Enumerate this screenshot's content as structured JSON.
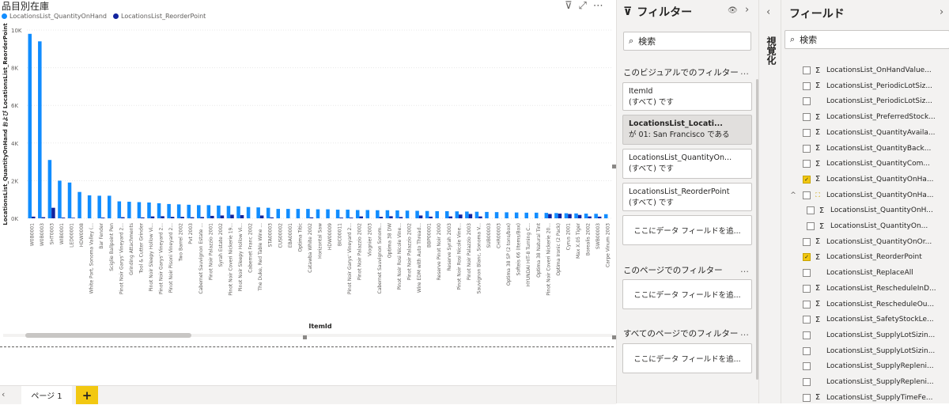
{
  "visual": {
    "title": "品目別在庫",
    "legend": [
      {
        "label": "LocationsList_QuantityOnHand",
        "color": "#118dff"
      },
      {
        "label": "LocationsList_ReorderPoint",
        "color": "#12239e"
      }
    ],
    "icons": [
      "filter-icon",
      "focus-mode-icon",
      "more-options-icon"
    ],
    "header_glyphs": {
      "filter": "⊽",
      "focus": "⤢",
      "more": "⋯"
    }
  },
  "chart_data": {
    "type": "bar",
    "title": "品目別在庫",
    "xlabel": "ItemId",
    "ylabel": "LocationsList_QuantityOnHand および LocationsList_ReorderPoint",
    "ylim": [
      0,
      10000
    ],
    "yticks": [
      "0K",
      "2K",
      "4K",
      "6K",
      "8K",
      "10K"
    ],
    "ytick_values": [
      0,
      2000,
      4000,
      6000,
      8000,
      10000
    ],
    "categories": [
      "W0B0001",
      "W0B0003",
      "SHT0003",
      "WIB0001",
      "LED00001",
      "HDW0008",
      "White Port, Sonoma Valley (...",
      "Bar Fender",
      "Sciglie Ballpoint Pen",
      "Pinot Noir Garys' Vineyard 2...",
      "Grinding Attachments",
      "Tool & Cutter Grinder",
      "Pinot Noir Sleepy Hollow Vi...",
      "Pinot Noir Garys' Vineyard 2...",
      "Pinot Noir Pisoni Vineyard 2...",
      "Two Barrel 2002",
      "Pvt 2003",
      "Cabernet Sauvignon Estate ...",
      "Pinot Noir Palazzio 2001",
      "Syrah Estate 2002",
      "Pinot Noir Coveri Nickerie 19...",
      "Pinot Noir Sleepy Hollow Vi...",
      "Cabernet Franc 2002",
      "The Duke, Red Table Wine ...",
      "STA00003",
      "CUS00002",
      "EBA00001",
      "Optima Titic",
      "Catawba White 2002",
      "Horizontal Saw",
      "HDW00009",
      "BIC00011",
      "Pinot Noir Garys' Vineyard 2...",
      "Pinot Noir Palazzio 2002",
      "Viognier 2003",
      "Cabernet Sauvignon Sonom...",
      "Optima 38 DW",
      "Pinot Noir Rosi Nicole Vine...",
      "Pinot Noir Palazzio 2002",
      "Wire EDM with Auto Thread...",
      "BBP00001",
      "Reserve Pinot Noir 2000",
      "Reserve Syrah 2003",
      "Pinot Noir Rosi Nicole Vine...",
      "Pinot Noir Palazzio 2003",
      "Sauvignon Blanc, Sonoma V...",
      "SUB00003",
      "CHR00003",
      "Optima 38 SP (2 tons/box)",
      "Softeis 66 (Items/Box)",
      "HYUNDAI HIT-8 Turning C...",
      "Optima 38 Natural Tint",
      "Pinot Noir Coveri Nickerie 20...",
      "Optima Ironic (2 Pack)",
      "Cyrus 2001",
      "Max X.05 Tiger",
      "Borealis 2002",
      "SWB00003",
      "Carpe Vinum 2003"
    ],
    "series": [
      {
        "name": "LocationsList_QuantityOnHand",
        "color": "#118dff",
        "values": [
          9800,
          9400,
          3100,
          2000,
          1900,
          1400,
          1220,
          1200,
          1200,
          900,
          880,
          860,
          840,
          800,
          760,
          740,
          720,
          700,
          700,
          680,
          660,
          640,
          600,
          580,
          560,
          500,
          500,
          500,
          500,
          480,
          480,
          460,
          460,
          440,
          440,
          430,
          430,
          420,
          410,
          400,
          390,
          380,
          380,
          370,
          360,
          350,
          340,
          330,
          320,
          310,
          300,
          300,
          290,
          280,
          270,
          260,
          250,
          240,
          220
        ]
      },
      {
        "name": "LocationsList_ReorderPoint",
        "color": "#12239e",
        "values": [
          90,
          60,
          560,
          40,
          30,
          0,
          0,
          40,
          0,
          60,
          0,
          50,
          100,
          110,
          80,
          80,
          60,
          70,
          130,
          150,
          190,
          170,
          0,
          150,
          50,
          0,
          0,
          0,
          50,
          0,
          0,
          40,
          40,
          100,
          0,
          80,
          110,
          70,
          0,
          150,
          90,
          0,
          100,
          200,
          230,
          100,
          0,
          0,
          0,
          0,
          0,
          0,
          230,
          250,
          230,
          180,
          100,
          90,
          0
        ]
      }
    ]
  },
  "pages": {
    "tab_label": "ページ 1",
    "add_label": "+",
    "nav_prev": "‹"
  },
  "filters": {
    "title": "フィルター",
    "search_placeholder": "検索",
    "glyphs": {
      "funnel": "⊽",
      "eye": "👁",
      "collapse": "›",
      "search": "⌕"
    },
    "visual_section": "このビジュアルでのフィルター",
    "page_section": "このページでのフィルター",
    "all_pages_section": "すべてのページでのフィルター",
    "more": "…",
    "cards": [
      {
        "name": "ItemId",
        "value": "(すべて) です"
      },
      {
        "name": "LocationsList_Locati...",
        "value": "が 01: San Francisco である"
      },
      {
        "name": "LocationsList_QuantityOn...",
        "value": "(すべて) です"
      },
      {
        "name": "LocationsList_ReorderPoint",
        "value": "(すべて) です"
      }
    ],
    "drop_label": "ここにデータ フィールドを追..."
  },
  "visualizations": {
    "label": "視覚化",
    "chevron": "‹"
  },
  "fields": {
    "title": "フィールド",
    "collapse": "›",
    "search_placeholder": "検索",
    "search_glyph": "⌕",
    "items": [
      {
        "label": "LocationsList_OnHandValue...",
        "icon": "Σ",
        "checked": false,
        "indent": 0
      },
      {
        "label": "LocationsList_PeriodicLotSiz...",
        "icon": "Σ",
        "checked": false,
        "indent": 0
      },
      {
        "label": "LocationsList_PeriodicLotSiz...",
        "icon": "",
        "checked": false,
        "indent": 0
      },
      {
        "label": "LocationsList_PreferredStock...",
        "icon": "Σ",
        "checked": false,
        "indent": 0
      },
      {
        "label": "LocationsList_QuantityAvaila...",
        "icon": "Σ",
        "checked": false,
        "indent": 0
      },
      {
        "label": "LocationsList_QuantityBack...",
        "icon": "Σ",
        "checked": false,
        "indent": 0
      },
      {
        "label": "LocationsList_QuantityCom...",
        "icon": "Σ",
        "checked": false,
        "indent": 0
      },
      {
        "label": "LocationsList_QuantityOnHa...",
        "icon": "Σ",
        "checked": true,
        "indent": 0
      },
      {
        "label": "LocationsList_QuantityOnHa...",
        "icon": "⛶",
        "checked": false,
        "indent": 0,
        "expander": "^",
        "hier": true
      },
      {
        "label": "LocationsList_QuantityOnH...",
        "icon": "Σ",
        "checked": false,
        "indent": 1
      },
      {
        "label": "LocationsList_QuantityOn...",
        "icon": "Σ",
        "checked": false,
        "indent": 1
      },
      {
        "label": "LocationsList_QuantityOnOr...",
        "icon": "Σ",
        "checked": false,
        "indent": 0
      },
      {
        "label": "LocationsList_ReorderPoint",
        "icon": "Σ",
        "checked": true,
        "indent": 0
      },
      {
        "label": "LocationsList_ReplaceAll",
        "icon": "",
        "checked": false,
        "indent": 0
      },
      {
        "label": "LocationsList_RescheduleInD...",
        "icon": "Σ",
        "checked": false,
        "indent": 0
      },
      {
        "label": "LocationsList_RescheduleOu...",
        "icon": "Σ",
        "checked": false,
        "indent": 0
      },
      {
        "label": "LocationsList_SafetyStockLe...",
        "icon": "Σ",
        "checked": false,
        "indent": 0
      },
      {
        "label": "LocationsList_SupplyLotSizin...",
        "icon": "",
        "checked": false,
        "indent": 0
      },
      {
        "label": "LocationsList_SupplyLotSizin...",
        "icon": "",
        "checked": false,
        "indent": 0
      },
      {
        "label": "LocationsList_SupplyRepleni...",
        "icon": "",
        "checked": false,
        "indent": 0
      },
      {
        "label": "LocationsList_SupplyRepleni...",
        "icon": "",
        "checked": false,
        "indent": 0
      },
      {
        "label": "LocationsList_SupplyTimeFe...",
        "icon": "Σ",
        "checked": false,
        "indent": 0
      }
    ]
  },
  "colors": {
    "accent_yellow": "#f2c811",
    "pane_bg": "#f3f2f1",
    "bar_primary": "#118dff",
    "bar_secondary": "#12239e"
  }
}
